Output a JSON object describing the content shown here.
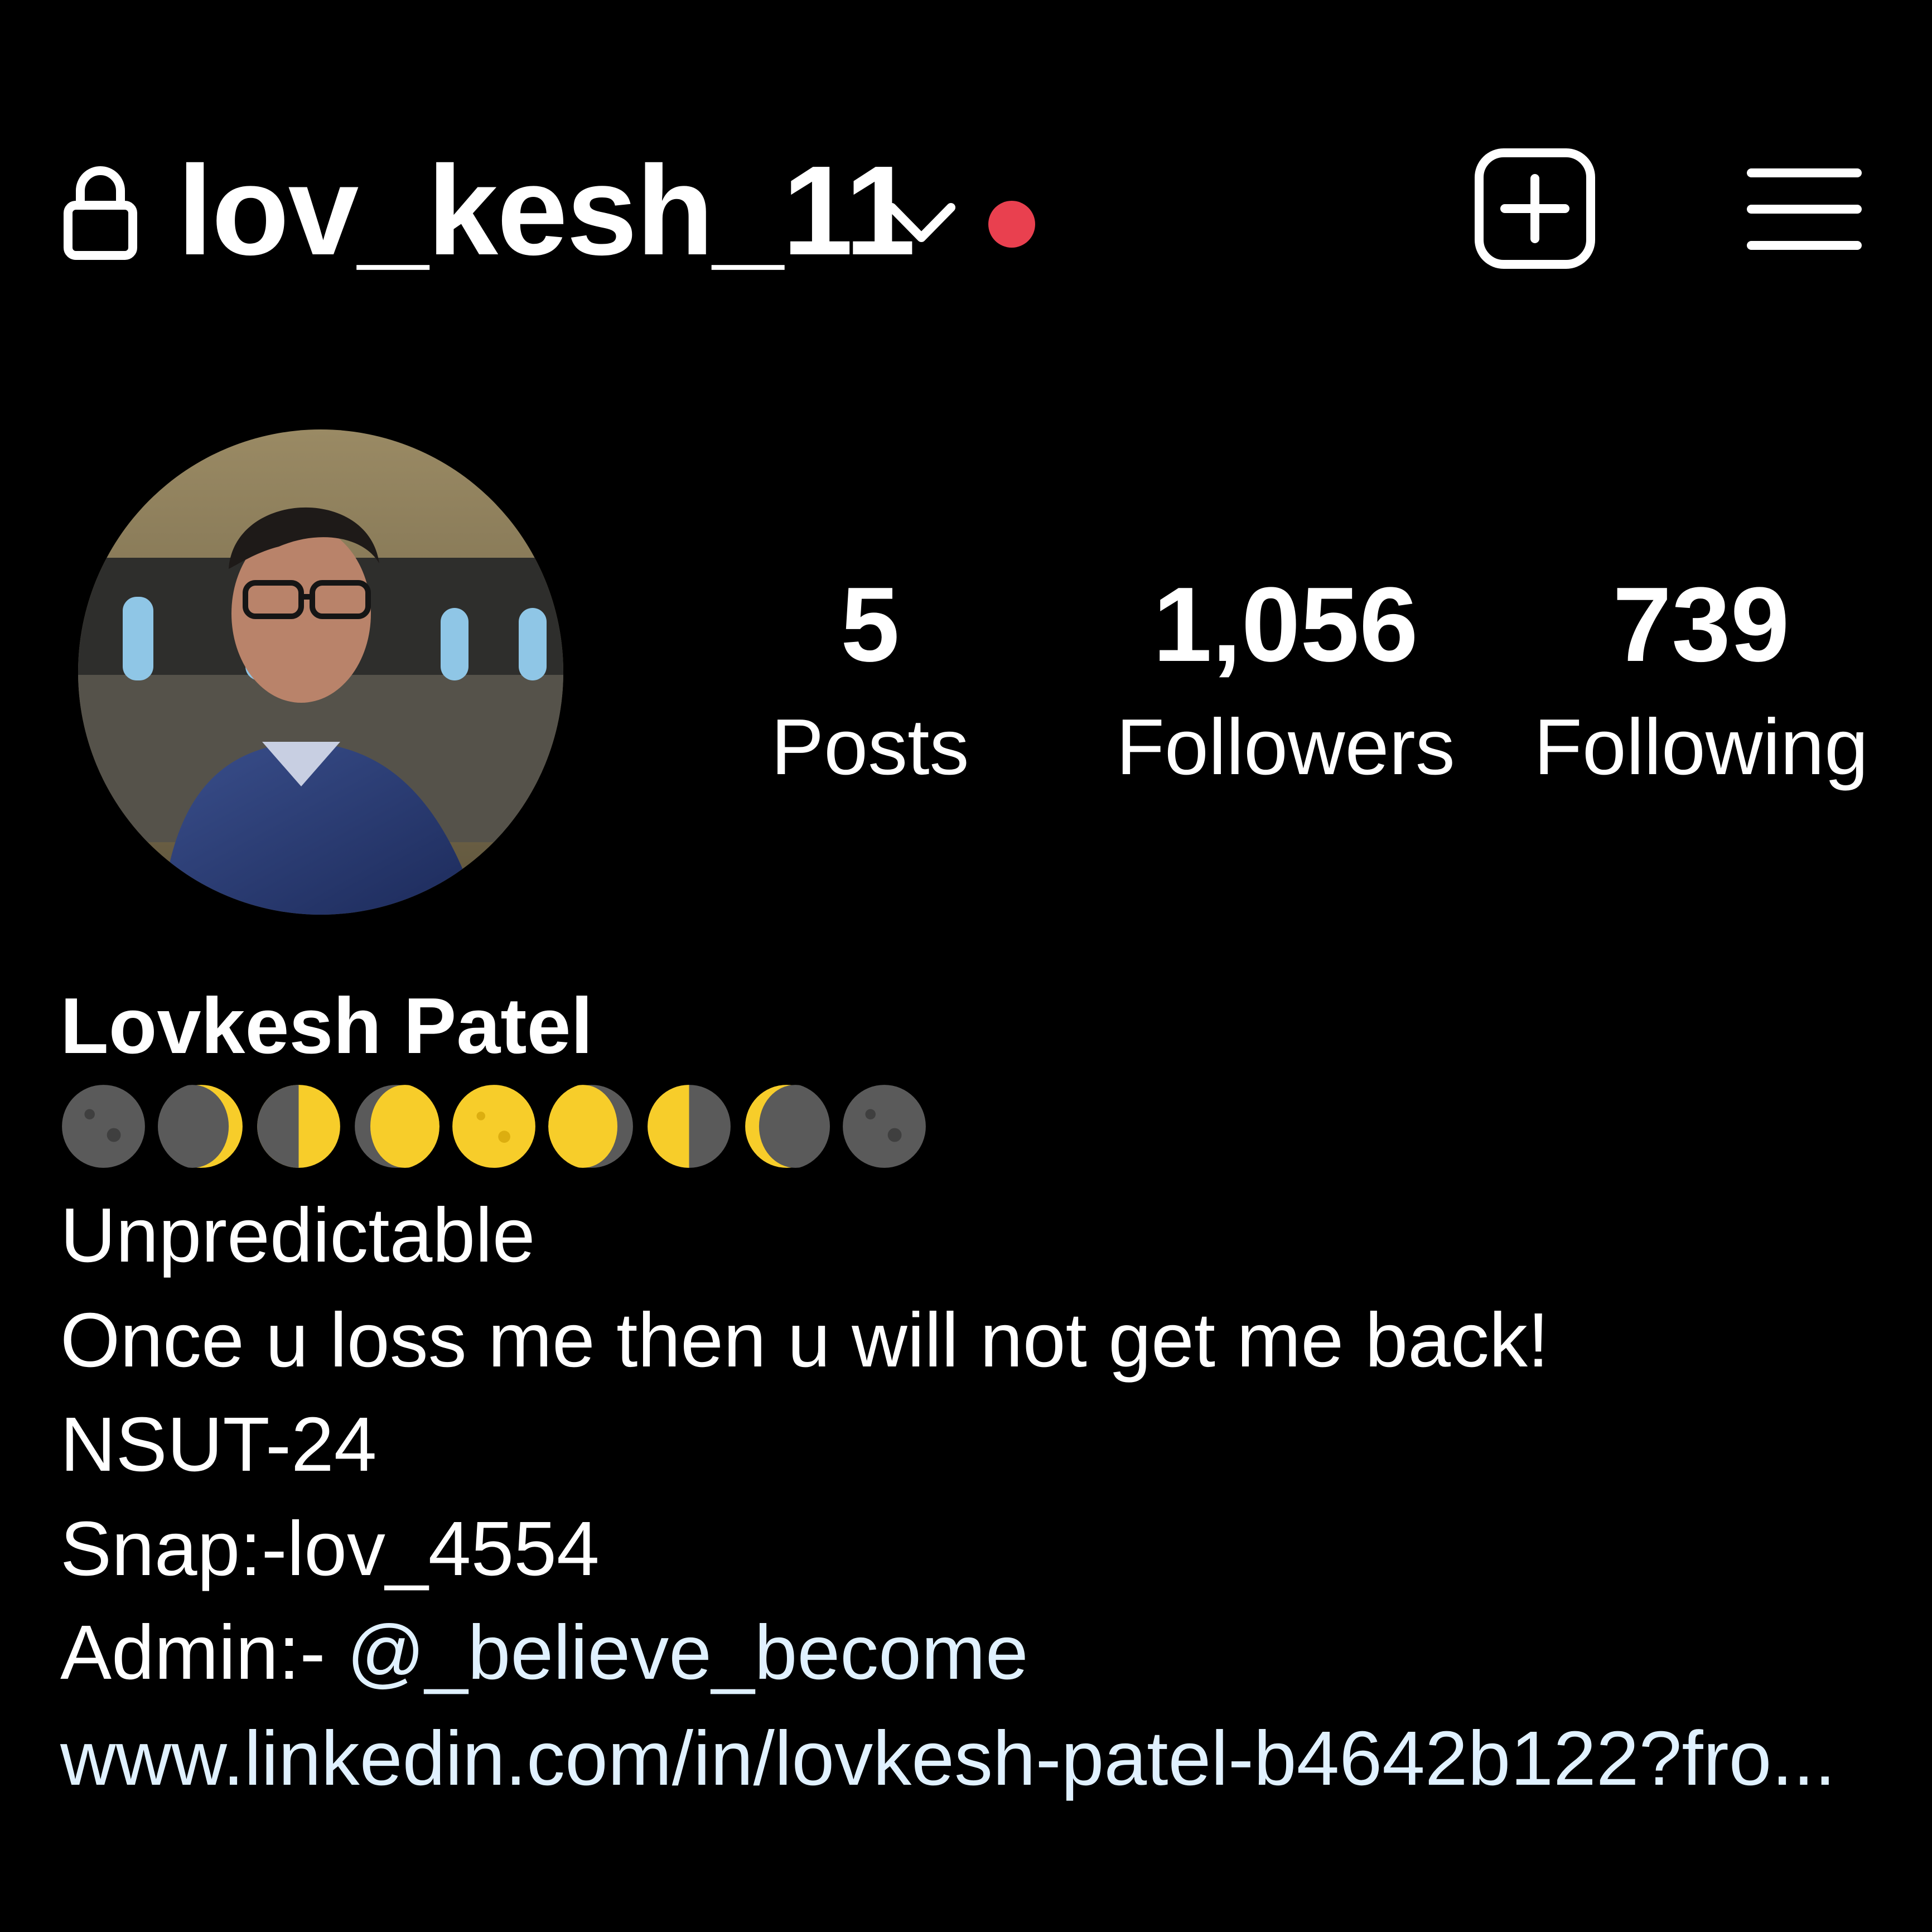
{
  "header": {
    "username": "lov_kesh_11",
    "icons": {
      "lock": "lock-icon",
      "switch_account": "chevron-down-icon",
      "new_post": "plus-square-icon",
      "menu": "hamburger-menu-icon"
    },
    "notification_dot_color": "#e9404f"
  },
  "profile": {
    "avatar": "profile-photo",
    "stats": {
      "posts": {
        "count": "5",
        "label": "Posts"
      },
      "followers": {
        "count": "1,056",
        "label": "Followers"
      },
      "following": {
        "count": "739",
        "label": "Following"
      }
    }
  },
  "bio": {
    "name": "Lovkesh Patel",
    "moon_phases": [
      "new-moon",
      "waxing-crescent",
      "first-quarter",
      "waxing-gibbous",
      "full-moon",
      "waning-gibbous",
      "last-quarter",
      "waning-crescent",
      "new-moon"
    ],
    "lines": [
      "Unpredictable",
      "Once u loss me then u will not get me back!",
      "NSUT-24",
      "Snap:-lov_4554"
    ],
    "admin_prefix": "Admin:- ",
    "admin_handle": "@_believe_become",
    "website": "www.linkedin.com/in/lovkesh-patel-b4642b122?fro..."
  },
  "colors": {
    "background": "#000000",
    "text": "#ffffff",
    "link": "#e0f1ff",
    "moon_yellow": "#f7cd2a",
    "moon_gray": "#5a5a5a"
  }
}
